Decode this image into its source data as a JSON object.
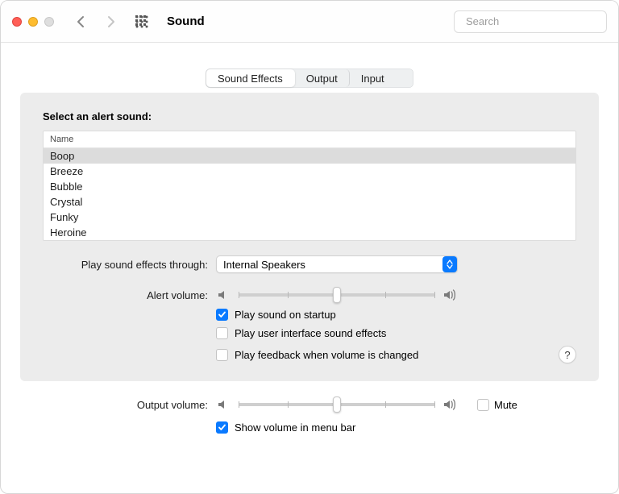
{
  "window": {
    "title": "Sound",
    "search_placeholder": "Search"
  },
  "tabs": {
    "sound_effects": "Sound Effects",
    "output": "Output",
    "input": "Input"
  },
  "section": {
    "heading": "Select an alert sound:",
    "column_header": "Name",
    "sounds": [
      "Boop",
      "Breeze",
      "Bubble",
      "Crystal",
      "Funky",
      "Heroine"
    ]
  },
  "play_through": {
    "label": "Play sound effects through:",
    "value": "Internal Speakers"
  },
  "alert_volume": {
    "label": "Alert volume:",
    "percent": 50
  },
  "checks": {
    "startup": {
      "label": "Play sound on startup",
      "checked": true
    },
    "ui_effects": {
      "label": "Play user interface sound effects",
      "checked": false
    },
    "feedback": {
      "label": "Play feedback when volume is changed",
      "checked": false
    }
  },
  "help": "?",
  "output_volume": {
    "label": "Output volume:",
    "percent": 50,
    "mute_label": "Mute",
    "mute_checked": false
  },
  "show_volume": {
    "label": "Show volume in menu bar",
    "checked": true
  }
}
